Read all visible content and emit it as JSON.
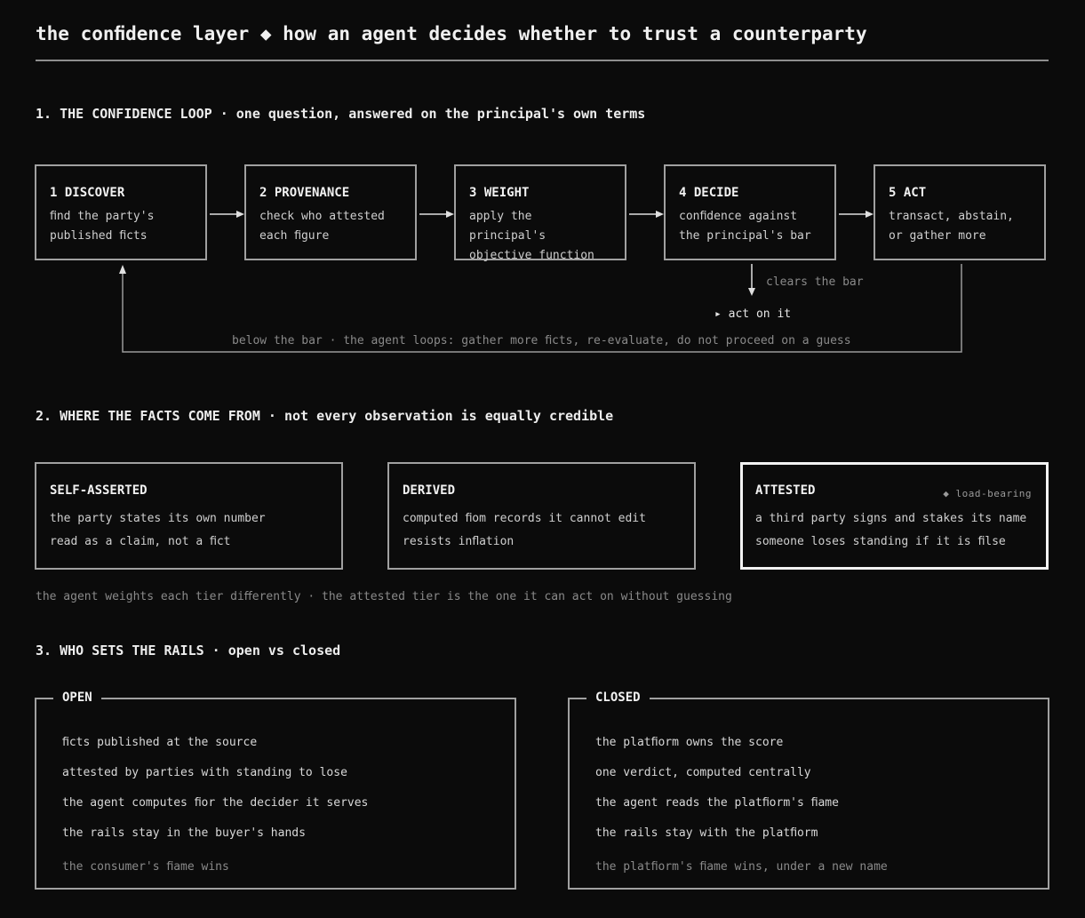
{
  "title": "the conﬁdence layer ◆ how an agent decides whether to trust a counterparty",
  "section1": {
    "heading": "1. THE CONFIDENCE LOOP · one question, answered on the principal's own terms",
    "steps": [
      {
        "title": "1 DISCOVER",
        "desc": "ﬁnd the party's\npublished ﬁcts"
      },
      {
        "title": "2 PROVENANCE",
        "desc": "check who attested\neach ﬁgure"
      },
      {
        "title": "3 WEIGHT",
        "desc": "apply the principal's\nobjective function"
      },
      {
        "title": "4 DECIDE",
        "desc": "conﬁdence against\nthe principal's bar"
      },
      {
        "title": "5 ACT",
        "desc": "transact, abstain,\nor gather more"
      }
    ],
    "clears_label": "clears the bar",
    "act_label": "▸ act on it",
    "loop_label": "below the bar · the agent loops: gather more ﬁcts, re-evaluate, do not proceed on a guess"
  },
  "section2": {
    "heading": "2. WHERE THE FACTS COME FROM · not every observation is equally credible",
    "tiers": [
      {
        "title": "SELF-ASSERTED",
        "line1": "the party states its own number",
        "line2": "read as a claim, not a ﬁct"
      },
      {
        "title": "DERIVED",
        "line1": "computed ﬁom records it cannot edit",
        "line2": "resists inﬂation"
      },
      {
        "title": "ATTESTED",
        "tag": "◆ load-bearing",
        "line1": "a third party signs and stakes its name",
        "line2": "someone loses standing if it is ﬁlse"
      }
    ],
    "footnote": "the agent weights each tier diﬀerently · the attested tier is the one it can act on without guessing"
  },
  "section3": {
    "heading": "3. WHO SETS THE RAILS · open vs closed",
    "open": {
      "title": "OPEN",
      "items": [
        "ﬁcts published at the source",
        "attested by parties with standing to lose",
        "the agent computes ﬁor the decider it serves",
        "the rails stay in the buyer's hands"
      ],
      "footer": "the consumer's ﬁame wins"
    },
    "closed": {
      "title": "CLOSED",
      "items": [
        "the platﬁorm owns the score",
        "one verdict, computed centrally",
        "the agent reads the platﬁorm's ﬁame",
        "the rails stay with the platﬁorm"
      ],
      "footer": "the platﬁorm's ﬁame wins, under a new name"
    }
  }
}
